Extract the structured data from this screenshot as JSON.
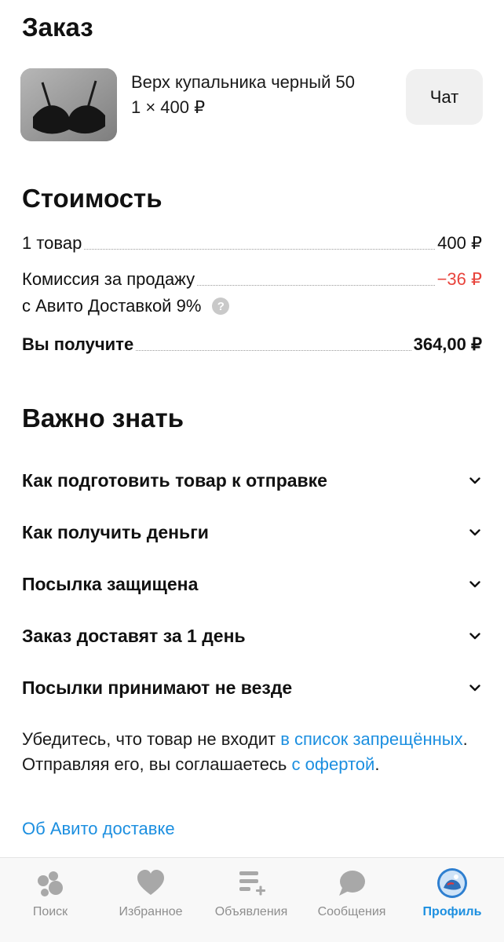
{
  "order": {
    "title": "Заказ",
    "product_name": "Верх купальника черный 50",
    "product_qty": "1 × 400 ₽",
    "chat_label": "Чат"
  },
  "cost": {
    "title": "Стоимость",
    "items_label": "1 товар",
    "items_value": "400 ₽",
    "commission_label": "Комиссия за продажу",
    "commission_label2": "с Авито Доставкой 9%",
    "commission_value": "−36 ₽",
    "total_label": "Вы получите",
    "total_value": "364,00 ₽"
  },
  "important": {
    "title": "Важно знать",
    "items": [
      {
        "label": "Как подготовить товар к отправке"
      },
      {
        "label": "Как получить деньги"
      },
      {
        "label": "Посылка защищена"
      },
      {
        "label": "Заказ доставят за 1 день"
      },
      {
        "label": "Посылки принимают не везде"
      }
    ]
  },
  "disclaimer": {
    "part1": "Убедитесь, что товар не входит ",
    "link1": "в список запрещённых",
    "part2": ". Отправляя его, вы соглашаетесь ",
    "link2": "с офертой",
    "part3": "."
  },
  "about_link": "Об Авито доставке",
  "tabbar": {
    "tabs": [
      {
        "label": "Поиск",
        "icon": "search-icon"
      },
      {
        "label": "Избранное",
        "icon": "heart-icon"
      },
      {
        "label": "Объявления",
        "icon": "listings-icon"
      },
      {
        "label": "Сообщения",
        "icon": "messages-icon"
      },
      {
        "label": "Профиль",
        "icon": "profile-avatar-icon",
        "active": true
      }
    ]
  },
  "colors": {
    "accent": "#1c8fe0",
    "negative": "#e8443c",
    "tab_inactive": "#8e8e8e"
  }
}
